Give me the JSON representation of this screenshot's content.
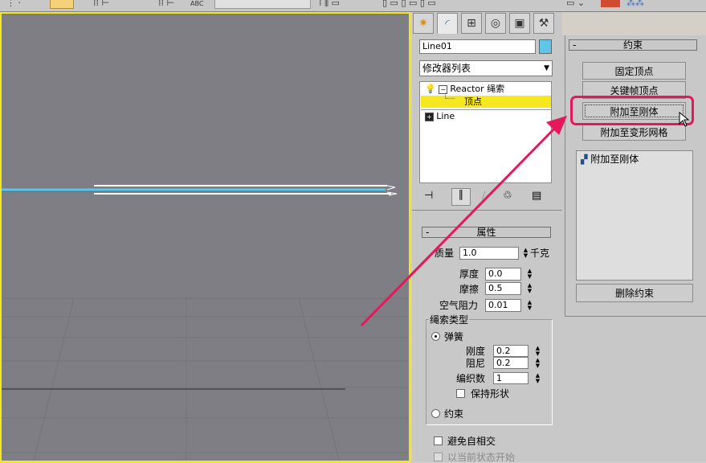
{
  "toolbar": {
    "abc_label": "ABC"
  },
  "colors": {
    "viewport_border": "#f7e71f",
    "highlight": "#f7e71f",
    "callout": "#e6185c",
    "object_swatch": "#5ec6e8"
  },
  "command_panel": {
    "tabs": [
      {
        "icon": "create-icon"
      },
      {
        "icon": "modify-icon"
      },
      {
        "icon": "hierarchy-icon"
      },
      {
        "icon": "motion-icon"
      },
      {
        "icon": "display-icon"
      },
      {
        "icon": "utilities-icon"
      }
    ],
    "object_name": "Line01",
    "modifier_list": "修改器列表",
    "stack": {
      "reactor_rope": "Reactor 绳索",
      "vertex": "顶点",
      "line": "Line"
    }
  },
  "properties": {
    "title": "属性",
    "mass_label": "质量",
    "mass_value": "1.0",
    "mass_unit": "千克",
    "thickness_label": "厚度",
    "thickness_value": "0.0",
    "friction_label": "摩擦",
    "friction_value": "0.5",
    "air_resistance_label": "空气阻力",
    "air_resistance_value": "0.01",
    "rope_type_label": "绳索类型",
    "spring_label": "弹簧",
    "stiffness_label": "刚度",
    "stiffness_value": "0.2",
    "damping_label": "阻尼",
    "damping_value": "0.2",
    "weave_label": "编织数",
    "weave_value": "1",
    "keep_shape_label": "保持形状",
    "constraint_label": "约束",
    "avoid_self_label": "避免自相交",
    "start_current_label": "以当前状态开始"
  },
  "constraints": {
    "title": "约束",
    "fix_vertex": "固定顶点",
    "keyframe_vertex": "关键帧顶点",
    "attach_rigid": "附加至刚体",
    "attach_deform": "附加至变形网格",
    "list_item": "附加至刚体",
    "delete": "删除约束"
  }
}
